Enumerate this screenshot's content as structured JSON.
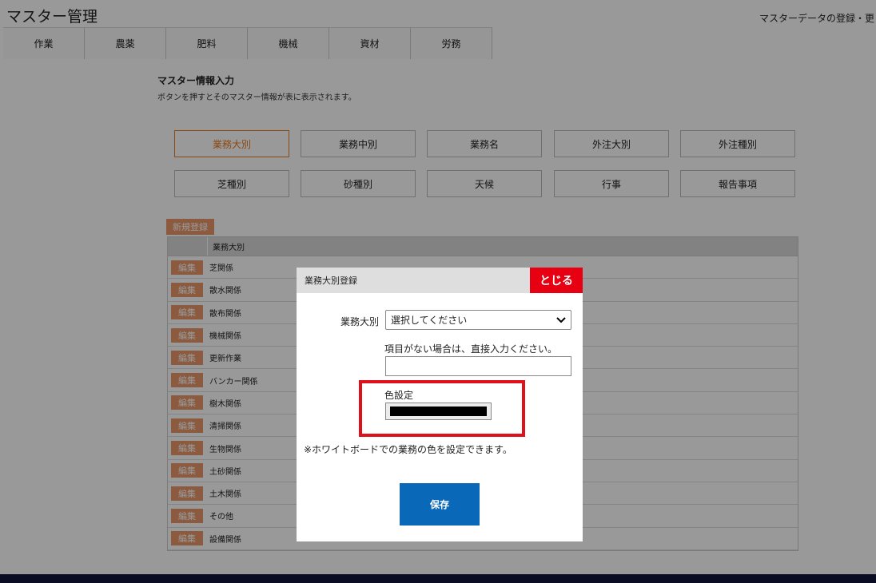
{
  "header": {
    "title": "マスター管理",
    "right_text": "マスターデータの登録・更"
  },
  "tabs": [
    "作業",
    "農薬",
    "肥料",
    "機械",
    "資材",
    "労務"
  ],
  "section": {
    "title": "マスター情報入力",
    "description": "ボタンを押すとそのマスター情報が表に表示されます。"
  },
  "category_buttons": [
    {
      "label": "業務大別",
      "active": true
    },
    {
      "label": "業務中別"
    },
    {
      "label": "業務名"
    },
    {
      "label": "外注大別"
    },
    {
      "label": "外注種別"
    },
    {
      "label": "芝種別"
    },
    {
      "label": "砂種別"
    },
    {
      "label": "天候"
    },
    {
      "label": "行事"
    },
    {
      "label": "報告事項"
    }
  ],
  "new_button": "新規登録",
  "table": {
    "header": "業務大別",
    "edit_label": "編集",
    "rows": [
      "芝関係",
      "散水関係",
      "散布関係",
      "機械関係",
      "更新作業",
      "バンカー関係",
      "樹木関係",
      "清掃関係",
      "生物関係",
      "土砂関係",
      "土木関係",
      "その他",
      "設備関係"
    ]
  },
  "modal": {
    "title": "業務大別登録",
    "close_label": "とじる",
    "field_label": "業務大別",
    "select_value": "選択してください",
    "hint": "項目がない場合は、直接入力ください。",
    "input_value": "",
    "color_label": "色設定",
    "color_value": "#000000",
    "note": "※ホワイトボードでの業務の色を設定できます。",
    "save_label": "保存"
  },
  "colors": {
    "accent_orange": "#e87a1f",
    "close_red": "#e60012",
    "save_blue": "#0a68b8",
    "highlight_red": "#e0101a"
  }
}
